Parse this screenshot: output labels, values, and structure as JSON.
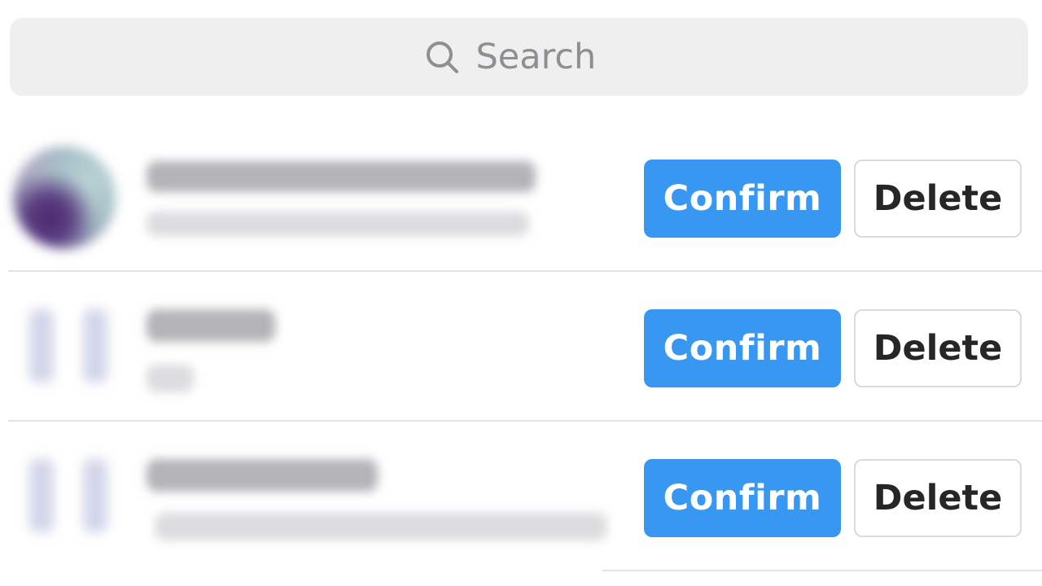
{
  "search": {
    "placeholder": "Search",
    "icon": "search-icon"
  },
  "colors": {
    "search_bg": "#efeff0",
    "confirm_bg": "#3897f0",
    "confirm_text": "#ffffff",
    "delete_border": "#dbdbdb",
    "delete_text": "#262626",
    "divider": "#e2e2e4"
  },
  "requests": [
    {
      "name": "",
      "subtitle": "",
      "confirm_label": "Confirm",
      "delete_label": "Delete"
    },
    {
      "name": "",
      "subtitle": "",
      "confirm_label": "Confirm",
      "delete_label": "Delete"
    },
    {
      "name": "",
      "subtitle": "",
      "confirm_label": "Confirm",
      "delete_label": "Delete"
    }
  ]
}
